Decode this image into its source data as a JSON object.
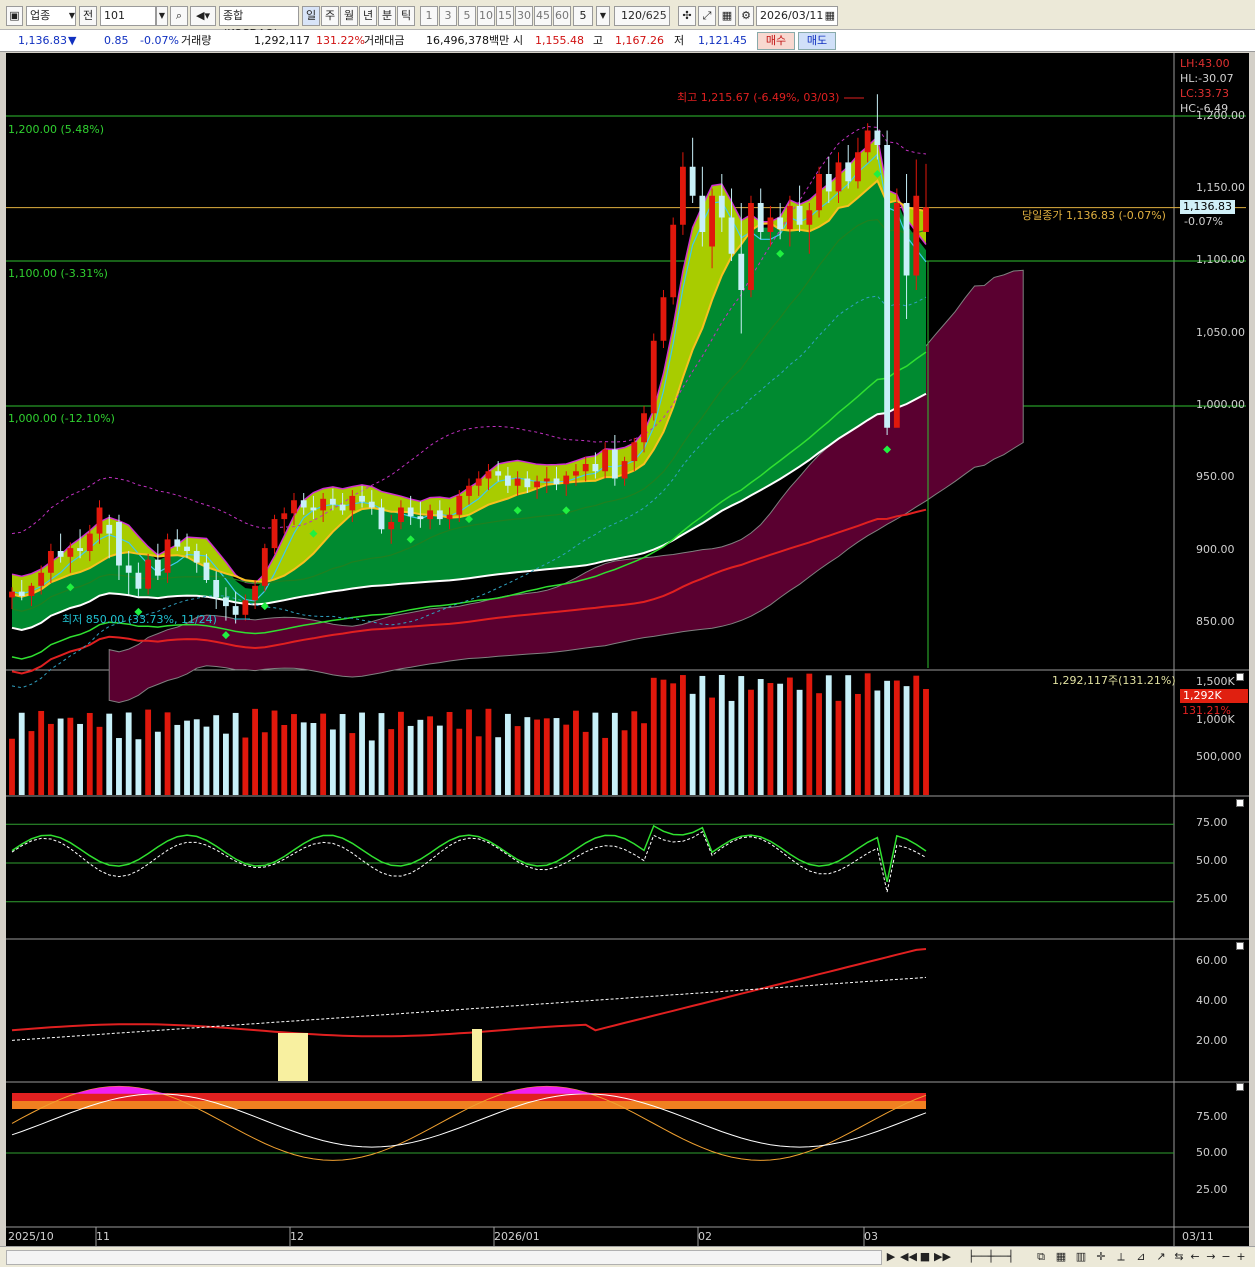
{
  "toolbar": {
    "market_type": "업종",
    "period_label": "전",
    "code": "101",
    "index_name": "종합(KOSDAQ)",
    "period_tabs": [
      "일",
      "주",
      "월",
      "년",
      "분",
      "틱"
    ],
    "intervals": [
      "1",
      "3",
      "5",
      "10",
      "15",
      "30",
      "45",
      "60"
    ],
    "custom_interval": "5",
    "count": "120",
    "total": "/625",
    "date": "2026/03/11"
  },
  "info": {
    "price": "1,136.83",
    "direction": "▼",
    "change": "0.85",
    "change_pct": "-0.07%",
    "volume_label": "거래량",
    "volume": "1,292,117",
    "volume_ratio": "131.22%",
    "amount_label": "거래대금",
    "amount": "16,496,378백만",
    "open_label": "시",
    "open": "1,155.48",
    "high_label": "고",
    "high": "1,167.26",
    "low_label": "저",
    "low": "1,121.45",
    "buy_button": "매수",
    "sell_button": "매도"
  },
  "main_panel": {
    "hline_labels": [
      "1,200.00 (5.48%)",
      "1,100.00 (-3.31%)",
      "1,000.00 (-12.10%)"
    ],
    "high_marker": "최고 1,215.67 (-6.49%, 03/03)",
    "low_marker": "최저 850.00 (33.73%, 11/24)",
    "close_label": "당일종가 1,136.83 (-0.07%)",
    "stats": [
      "LH:43.00",
      "HL:-30.07",
      "LC:33.73",
      "HC:-6.49"
    ],
    "price_box": "1,136.83",
    "price_box_pct": "-0.07%",
    "y_ticks": [
      "1,200.00",
      "1,150.00",
      "1,100.00",
      "1,050.00",
      "1,000.00",
      "950.00",
      "900.00",
      "850.00"
    ],
    "colors": {
      "up": "#e0180c",
      "down": "#c8f0f8",
      "cloud": "#5a0030",
      "bull_fill": "#008a30",
      "yellow_fill": "#a8cc00"
    }
  },
  "volume_panel": {
    "label": "1,292,117주(131.21%)",
    "y_ticks": [
      "1,500K",
      "1,000K",
      "500,000"
    ],
    "box_value": "1,292K",
    "box_pct": "131.21%"
  },
  "rsi_panel": {
    "y_ticks": [
      "75.00",
      "50.00",
      "25.00"
    ]
  },
  "adx_panel": {
    "y_ticks": [
      "60.00",
      "40.00",
      "20.00"
    ]
  },
  "stoch_panel": {
    "y_ticks": [
      "75.00",
      "50.00",
      "25.00"
    ]
  },
  "x_axis": {
    "labels": [
      "2025/10",
      "11",
      "12",
      "2026/01",
      "02",
      "03",
      "03/11"
    ]
  },
  "chart_data": {
    "type": "candlestick",
    "candles": [
      [
        868,
        875,
        860,
        872
      ],
      [
        872,
        880,
        866,
        869
      ],
      [
        869,
        878,
        862,
        876
      ],
      [
        876,
        890,
        870,
        885
      ],
      [
        885,
        905,
        878,
        900
      ],
      [
        900,
        912,
        892,
        896
      ],
      [
        896,
        906,
        885,
        902
      ],
      [
        902,
        915,
        895,
        900
      ],
      [
        900,
        918,
        893,
        912
      ],
      [
        912,
        935,
        905,
        930
      ],
      [
        918,
        925,
        895,
        912
      ],
      [
        920,
        925,
        880,
        890
      ],
      [
        890,
        900,
        870,
        885
      ],
      [
        885,
        892,
        868,
        874
      ],
      [
        874,
        898,
        870,
        894
      ],
      [
        894,
        905,
        880,
        883
      ],
      [
        885,
        912,
        878,
        908
      ],
      [
        908,
        915,
        900,
        903
      ],
      [
        903,
        912,
        895,
        900
      ],
      [
        900,
        905,
        885,
        892
      ],
      [
        892,
        898,
        878,
        880
      ],
      [
        880,
        886,
        860,
        868
      ],
      [
        868,
        875,
        852,
        862
      ],
      [
        862,
        872,
        850,
        856
      ],
      [
        856,
        870,
        852,
        866
      ],
      [
        866,
        880,
        860,
        876
      ],
      [
        876,
        905,
        872,
        902
      ],
      [
        902,
        925,
        898,
        922
      ],
      [
        922,
        930,
        912,
        926
      ],
      [
        926,
        940,
        918,
        935
      ],
      [
        935,
        940,
        925,
        930
      ],
      [
        930,
        938,
        922,
        928
      ],
      [
        928,
        940,
        920,
        936
      ],
      [
        936,
        943,
        928,
        932
      ],
      [
        932,
        940,
        925,
        928
      ],
      [
        928,
        942,
        920,
        938
      ],
      [
        938,
        945,
        930,
        934
      ],
      [
        934,
        942,
        925,
        930
      ],
      [
        930,
        936,
        912,
        915
      ],
      [
        915,
        925,
        905,
        920
      ],
      [
        920,
        935,
        915,
        930
      ],
      [
        930,
        938,
        918,
        924
      ],
      [
        924,
        934,
        916,
        922
      ],
      [
        922,
        932,
        915,
        928
      ],
      [
        928,
        935,
        918,
        922
      ],
      [
        922,
        930,
        915,
        925
      ],
      [
        925,
        942,
        920,
        938
      ],
      [
        938,
        950,
        932,
        945
      ],
      [
        945,
        955,
        938,
        950
      ],
      [
        950,
        960,
        942,
        955
      ],
      [
        955,
        962,
        948,
        952
      ],
      [
        952,
        958,
        940,
        945
      ],
      [
        945,
        955,
        938,
        950
      ],
      [
        950,
        955,
        940,
        944
      ],
      [
        944,
        952,
        936,
        948
      ],
      [
        948,
        958,
        940,
        950
      ],
      [
        950,
        958,
        942,
        946
      ],
      [
        946,
        955,
        938,
        952
      ],
      [
        952,
        960,
        945,
        955
      ],
      [
        955,
        965,
        948,
        960
      ],
      [
        960,
        968,
        950,
        955
      ],
      [
        955,
        975,
        950,
        970
      ],
      [
        970,
        980,
        945,
        950
      ],
      [
        950,
        965,
        945,
        962
      ],
      [
        962,
        978,
        955,
        975
      ],
      [
        975,
        1000,
        968,
        995
      ],
      [
        995,
        1050,
        990,
        1045
      ],
      [
        1045,
        1080,
        1040,
        1075
      ],
      [
        1075,
        1130,
        1070,
        1125
      ],
      [
        1125,
        1175,
        1118,
        1165
      ],
      [
        1165,
        1185,
        1140,
        1145
      ],
      [
        1145,
        1165,
        1110,
        1120
      ],
      [
        1110,
        1150,
        1095,
        1145
      ],
      [
        1145,
        1160,
        1120,
        1130
      ],
      [
        1130,
        1150,
        1100,
        1105
      ],
      [
        1105,
        1140,
        1050,
        1080
      ],
      [
        1080,
        1145,
        1075,
        1140
      ],
      [
        1140,
        1150,
        1115,
        1120
      ],
      [
        1120,
        1138,
        1110,
        1130
      ],
      [
        1130,
        1140,
        1115,
        1122
      ],
      [
        1122,
        1145,
        1110,
        1138
      ],
      [
        1138,
        1152,
        1120,
        1125
      ],
      [
        1125,
        1140,
        1105,
        1135
      ],
      [
        1135,
        1165,
        1130,
        1160
      ],
      [
        1160,
        1172,
        1140,
        1148
      ],
      [
        1148,
        1175,
        1140,
        1168
      ],
      [
        1168,
        1180,
        1150,
        1155
      ],
      [
        1155,
        1185,
        1150,
        1175
      ],
      [
        1175,
        1195,
        1168,
        1190
      ],
      [
        1190,
        1215,
        1170,
        1180
      ],
      [
        1180,
        1190,
        980,
        985
      ],
      [
        985,
        1150,
        990,
        1140
      ],
      [
        1140,
        1160,
        1060,
        1090
      ],
      [
        1090,
        1170,
        1080,
        1145
      ],
      [
        1120,
        1167,
        1121,
        1137
      ]
    ]
  }
}
